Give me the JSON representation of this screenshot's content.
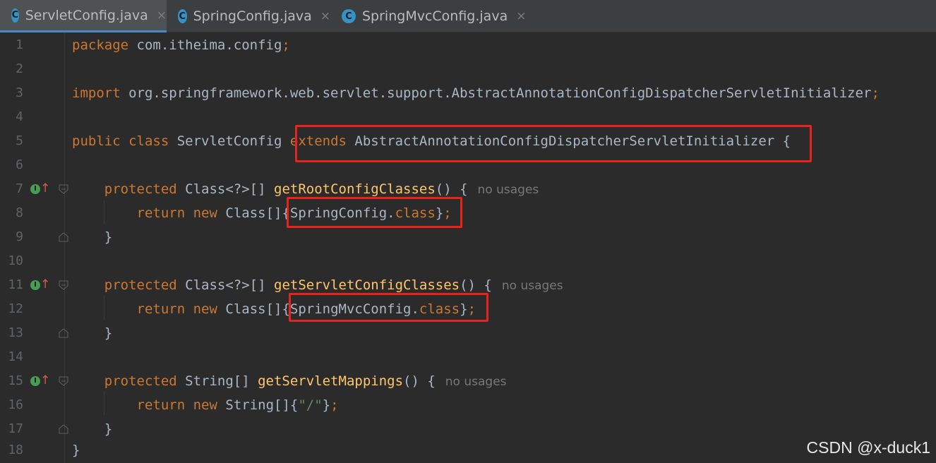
{
  "tabs": [
    {
      "label": "ServletConfig.java",
      "icon": "C",
      "active": true
    },
    {
      "label": "SpringConfig.java",
      "icon": "C",
      "active": false
    },
    {
      "label": "SpringMvcConfig.java",
      "icon": "C",
      "active": false
    }
  ],
  "tab_close_glyph": "×",
  "implement_glyph": "I",
  "implement_arrow": "↑",
  "lines": {
    "n1": "1",
    "n2": "2",
    "n3": "3",
    "n4": "4",
    "n5": "5",
    "n6": "6",
    "n7": "7",
    "n8": "8",
    "n9": "9",
    "n10": "10",
    "n11": "11",
    "n12": "12",
    "n13": "13",
    "n14": "14",
    "n15": "15",
    "n16": "16",
    "n17": "17",
    "n18": "18"
  },
  "code": {
    "kw_package": "package",
    "package_name": " com.itheima.config",
    "semicolon": ";",
    "kw_import": "import",
    "import_name": " org.springframework.web.servlet.support.AbstractAnnotationConfigDispatcherServletInitializer",
    "kw_public": "public",
    "kw_class": "class",
    "class_name": " ServletConfig ",
    "kw_extends": "extends",
    "superclass": " AbstractAnnotationConfigDispatcherServletInitializer",
    "open_brace": " {",
    "kw_protected": "protected",
    "class_array_type": " Class<?>[] ",
    "string_array_type": " String[] ",
    "m1": "getRootConfigClasses",
    "m2": "getServletConfigClasses",
    "m3": "getServletMappings",
    "parens_brace": "() {",
    "kw_return": "return",
    "kw_new": "new",
    "new_class_array": " Class[]",
    "new_string_array": " String[]",
    "spring_config": "{SpringConfig.",
    "spring_mvc_config": "{SpringMvcConfig.",
    "kw_class_literal": "class",
    "close_brace": "}",
    "open_curly": "{",
    "slash_string": "\"/\"",
    "hint": "no usages"
  },
  "watermark": "CSDN @x-duck1"
}
